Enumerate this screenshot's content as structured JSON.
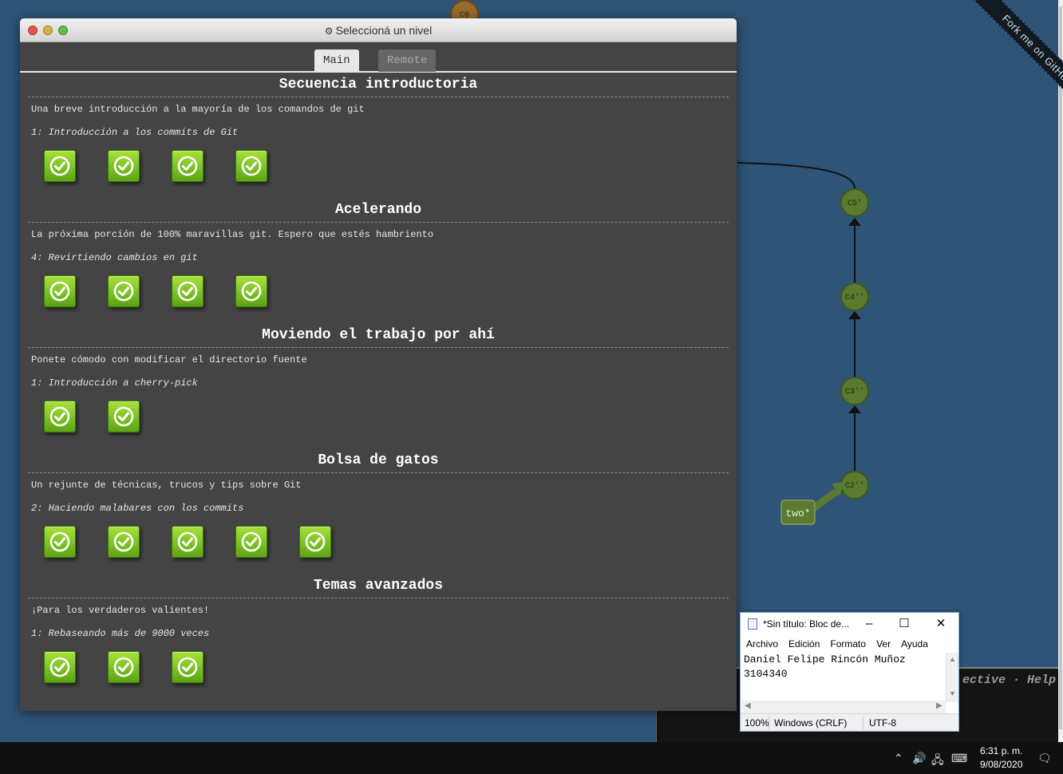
{
  "dialog": {
    "title": "Seleccioná un nivel",
    "tabs": [
      {
        "label": "Main",
        "active": true
      },
      {
        "label": "Remote",
        "active": false
      }
    ],
    "sequences": [
      {
        "title": "Secuencia introductoria",
        "about": "Una breve introducción a la mayoría de los comandos de git",
        "level": "1: Introducción a los commits de Git",
        "completed": 4
      },
      {
        "title": "Acelerando",
        "about": "La próxima porción de 100% maravillas git. Espero que estés hambriento",
        "level": "4: Revirtiendo cambios en git",
        "completed": 4
      },
      {
        "title": "Moviendo el trabajo por ahí",
        "about": "Ponete cómodo con modificar el directorio fuente",
        "level": "1: Introducción a cherry-pick",
        "completed": 2
      },
      {
        "title": "Bolsa de gatos",
        "about": "Un rejunte de técnicas, trucos y tips sobre Git",
        "level": "2: Haciendo malabares con los commits",
        "completed": 5
      },
      {
        "title": "Temas avanzados",
        "about": "¡Para los verdaderos valientes!",
        "level": "1: Rebaseando más de 9000 veces",
        "completed": 3
      }
    ]
  },
  "graph": {
    "nodes": [
      "C0",
      "C5'",
      "C4''",
      "C3''",
      "C2''"
    ],
    "branch": "two*",
    "node_color": "#5a7a2e",
    "top_node_color": "#9a6a2a"
  },
  "ribbon": "Fork me on GitHub",
  "command_bar": {
    "links": "ective · Help"
  },
  "notepad": {
    "title": "*Sin título: Bloc de...",
    "menu": [
      "Archivo",
      "Edición",
      "Formato",
      "Ver",
      "Ayuda"
    ],
    "line1": "Daniel Felipe Rincón Muñoz",
    "line2": "3104340",
    "zoom": "100%",
    "eol": "Windows (CRLF)",
    "encoding": "UTF-8"
  },
  "taskbar": {
    "time": "6:31 p. m.",
    "date": "9/08/2020"
  }
}
